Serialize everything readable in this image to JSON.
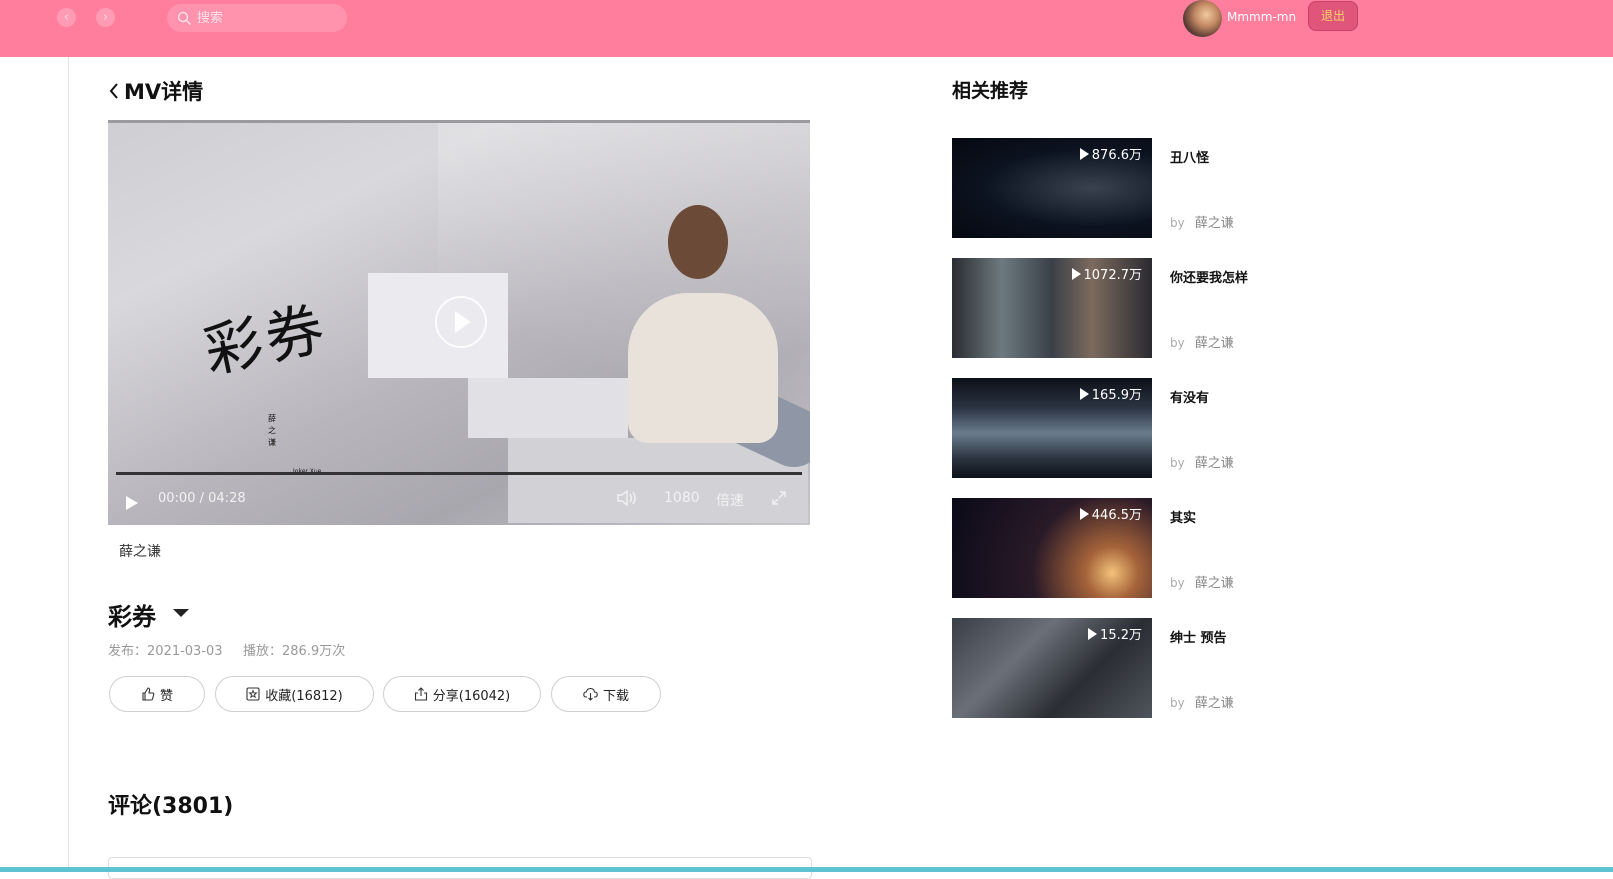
{
  "topbar": {
    "search_placeholder": "搜索",
    "username": "Mmmm-mn",
    "logout_label": "退出"
  },
  "mv": {
    "page_title": "MV详情",
    "artist": "薛之谦",
    "title": "彩券",
    "publish_label": "发布：2021-03-03",
    "plays_label": "播放：286.9万次",
    "player": {
      "current_time": "00:00",
      "separator": "/",
      "duration": "04:28",
      "quality": "1080",
      "speed_label": "倍速",
      "progress": 0,
      "poster_title": "彩券",
      "poster_artist_lines": [
        "薛",
        "之",
        "谦"
      ],
      "poster_artist_en": "Joker Xue"
    }
  },
  "actions": {
    "like": "赞",
    "collect": "收藏(16812)",
    "share": "分享(16042)",
    "download": "下载"
  },
  "comments": {
    "heading": "评论(3801)"
  },
  "recommendations": {
    "heading": "相关推荐",
    "by_label": "by",
    "items": [
      {
        "title": "丑八怪",
        "artist": "薛之谦",
        "plays": "876.6万"
      },
      {
        "title": "你还要我怎样",
        "artist": "薛之谦",
        "plays": "1072.7万"
      },
      {
        "title": "有没有",
        "artist": "薛之谦",
        "plays": "165.9万"
      },
      {
        "title": "其实",
        "artist": "薛之谦",
        "plays": "446.5万"
      },
      {
        "title": "绅士 预告",
        "artist": "薛之谦",
        "plays": "15.2万"
      }
    ]
  },
  "colors": {
    "topbar": "#ff7e9e",
    "logout_bg": "#e0557a",
    "logout_text": "#f6d36a",
    "bottom_bar": "#5ec4d4"
  }
}
